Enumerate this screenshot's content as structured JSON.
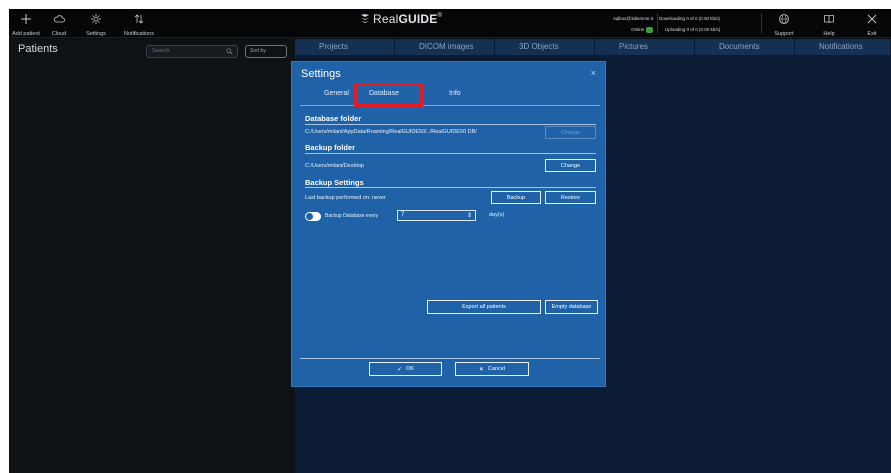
{
  "toolbar": {
    "add_patient": "Add patient",
    "cloud": "Cloud",
    "settings": "Settings",
    "notifications": "Notifications",
    "support": "Support",
    "help": "Help",
    "exit": "Exit"
  },
  "logo": {
    "name_light": "Real",
    "name_bold": "GUIDE",
    "mark": "®"
  },
  "account": {
    "email": "sqlbox@3diemme.it",
    "status_label": "Online",
    "status_badge": " "
  },
  "transfer": {
    "downloading": "Downloading 0 of 0 (0.00 kb/s)",
    "uploading": "Uploading 0 of 0 (0.00 kb/s)"
  },
  "patients": {
    "title": "Patients",
    "search_placeholder": "Search",
    "sort_by": "Sort by"
  },
  "tabs": [
    "Projects",
    "DICOM images",
    "3D Objects",
    "Pictures",
    "Documents",
    "Notifications"
  ],
  "dialog": {
    "title": "Settings",
    "close": "×",
    "tabs": {
      "general": "General",
      "database": "Database",
      "info": "Info"
    },
    "database_folder": {
      "heading": "Database folder",
      "path": "C:/Users/milani/AppData/Roaming/RealGUIDE50/../RealGUIDE50 DB/",
      "change": "Change"
    },
    "backup_folder": {
      "heading": "Backup folder",
      "path": "C:/Users/milani/Desktop",
      "change": "Change"
    },
    "backup_settings": {
      "heading": "Backup Settings",
      "last_backup": "Last backup performed on:  never",
      "backup": "Backup",
      "restore": "Restore",
      "backup_every": "Backup Database every",
      "days_value": "7",
      "days_unit": "day(s)"
    },
    "export_all": "Export all patients",
    "empty_database": "Empty database",
    "ok": "OK",
    "cancel": "Cancel"
  },
  "colors": {
    "dialog_bg": "#1f62a8",
    "highlight": "#e31b23",
    "online": "#3f9d3f",
    "app_bg": "#0b0d10"
  }
}
